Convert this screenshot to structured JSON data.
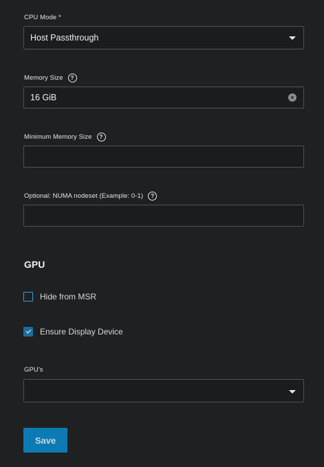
{
  "cpu_mode": {
    "label": "CPU Mode *",
    "value": "Host Passthrough"
  },
  "memory_size": {
    "label": "Memory Size",
    "value": "16 GiB"
  },
  "minimum_memory_size": {
    "label": "Minimum Memory Size",
    "value": ""
  },
  "numa_nodeset": {
    "label": "Optional: NUMA nodeset (Example: 0-1)",
    "value": ""
  },
  "gpu_section": {
    "title": "GPU",
    "hide_from_msr": {
      "label": "Hide from MSR",
      "checked": false
    },
    "ensure_display_device": {
      "label": "Ensure Display Device",
      "checked": true
    },
    "gpus": {
      "label": "GPU's",
      "value": ""
    }
  },
  "actions": {
    "save_label": "Save"
  },
  "icons": {
    "help": "?",
    "clear": "×"
  },
  "colors": {
    "background": "#1f2022",
    "primary_button": "#0c7bb3",
    "checkbox_accent": "#1c6d9c"
  }
}
